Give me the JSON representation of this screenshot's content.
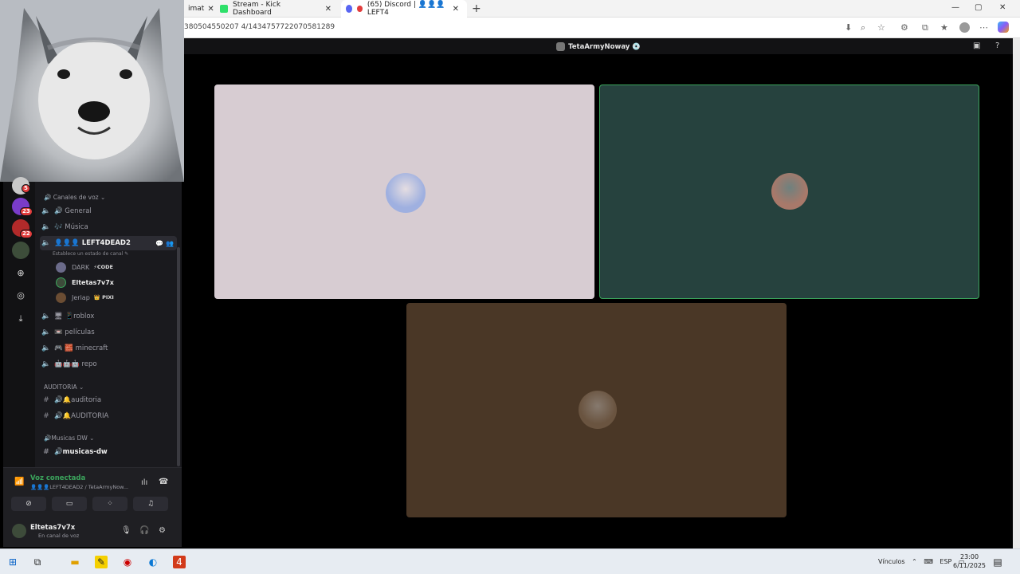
{
  "browser": {
    "tabs": [
      {
        "label": "imat",
        "active": false
      },
      {
        "label": "Stream - Kick Dashboard",
        "active": false
      },
      {
        "label": "(65) Discord | 👤👤👤LEFT4",
        "active": true
      }
    ],
    "new_tab": "+",
    "window_min": "—",
    "window_max": "▢",
    "window_close": "✕",
    "url": "380504550207 4/1434757722070581289"
  },
  "discord_strip": {
    "title": "TetaArmyNoway 💿"
  },
  "servers": [
    {
      "badge": "5",
      "color": "#c9c9c9"
    },
    {
      "badge": "23",
      "color": "#7a3cc9"
    },
    {
      "badge": "22",
      "color": "#b22a2a"
    },
    {
      "badge": "",
      "color": "#3d4d3a"
    }
  ],
  "channels": {
    "voice_category": "🔊 Canales de voz ⌄",
    "items": [
      {
        "label": "🔊 General",
        "active": false
      },
      {
        "label": "🎶 Música",
        "active": false
      },
      {
        "label": "👤👤👤 LEFT4DEAD2",
        "active": true
      },
      {
        "label": "🖥 📱roblox",
        "active": false
      },
      {
        "label": "📼 películas",
        "active": false
      },
      {
        "label": "🎮 🧱 minecraft",
        "active": false
      },
      {
        "label": "🤖🤖🤖 repo",
        "active": false
      }
    ],
    "active_status": "Establece un estado de canal ✎",
    "members": [
      {
        "name": "DARK",
        "tag": "⚡CODE",
        "color": "#6b6b8a"
      },
      {
        "name": "Eltetas7v7x",
        "tag": "",
        "color": "#3d4b3a"
      },
      {
        "name": "Jeriap",
        "tag": "👑 PIXI",
        "color": "#6b4d33"
      }
    ],
    "audit_category": "AUDITORIA ⌄",
    "audit_items": [
      {
        "label": "🔊🔔auditoria"
      },
      {
        "label": "🔊🔔AUDITORIA"
      }
    ],
    "music_category": "🔊Musicas DW ⌄",
    "music_items": [
      {
        "label": "🔊musicas-dw"
      }
    ]
  },
  "voice_panel": {
    "status": "Voz conectada",
    "channel": "👤👤👤LEFT4DEAD2 / TetaArmyNow...",
    "username": "Eltetas7v7x",
    "user_status": "En canal de voz"
  },
  "taskbar": {
    "tray_label": "Vínculos",
    "lang": "ESP",
    "time": "23:00",
    "date": "6/11/2025"
  },
  "tiles": [
    {
      "bg": "#d7ccd2",
      "border": "#d7ccd2",
      "avatar": "#9fb0e0"
    },
    {
      "bg": "#26423e",
      "border": "#3ba55c",
      "avatar": "#a8796a"
    },
    {
      "bg": "#4a3726",
      "border": "#4a3726",
      "avatar": "#6a5440"
    }
  ]
}
